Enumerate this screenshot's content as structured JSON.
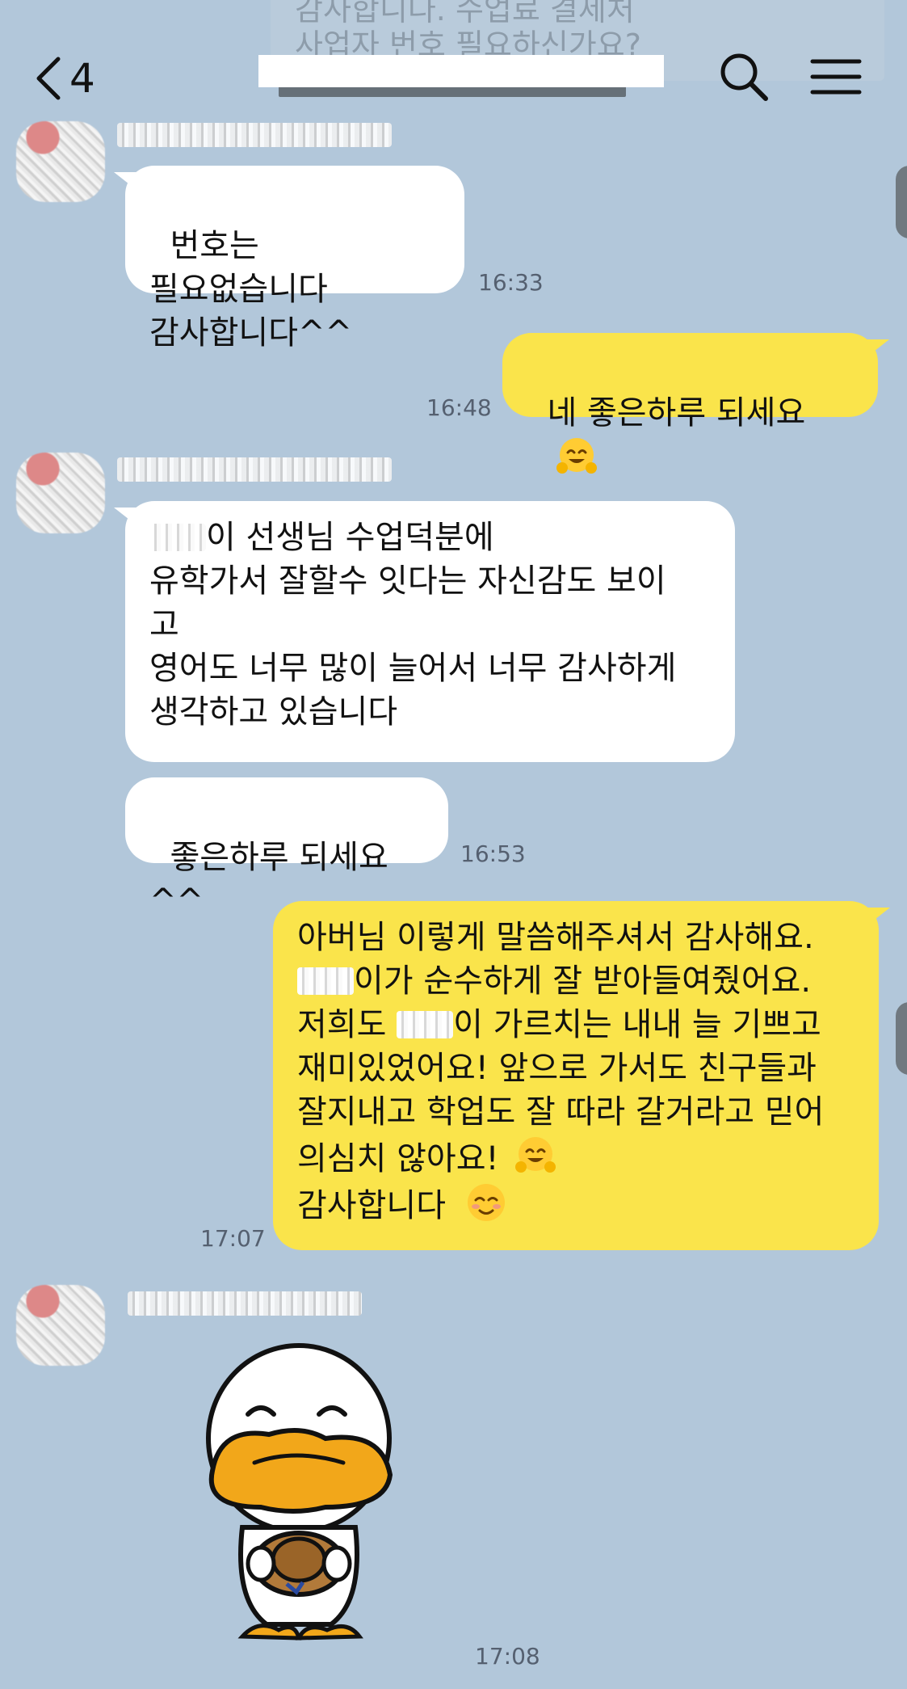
{
  "header": {
    "back_count": "4",
    "ghost_notice_line1": "감사합니다. 수업료 결제처",
    "ghost_notice_line2": "사업자 번호 필요하신가요?"
  },
  "messages": [
    {
      "side": "in",
      "text": "번호는 필요없습니다\n감사합니다^^",
      "time": "16:33"
    },
    {
      "side": "out",
      "text": "네 좋은하루 되세요",
      "time": "16:48"
    },
    {
      "side": "in",
      "text_parts": [
        "이 선생님 수업덕분에\n유학가서 잘할수 잇다는 자신감도 보이\n고\n영어도 너무 많이 늘어서 너무 감사하게\n생각하고 있습니다"
      ]
    },
    {
      "side": "in",
      "text": "좋은하루 되세요^^",
      "time": "16:53"
    },
    {
      "side": "out",
      "line1": "아버님 이렇게 말씀해주셔서 감사해요.",
      "line2": "이가 순수하게 잘 받아들여줬어요.",
      "line3a": "저희도 ",
      "line3b": "이 가르치는 내내 늘 기쁘고",
      "line4": "재미있었어요! 앞으로 가서도 친구들과",
      "line5": "잘지내고 학업도 잘 따라 갈거라고 믿어",
      "line6": "의심치 않아요!",
      "line7": "감사합니다",
      "time": "17:07"
    },
    {
      "side": "in",
      "type": "sticker",
      "sticker": "duck-with-hat-bowing",
      "time": "17:08"
    }
  ],
  "colors": {
    "background": "#b2c7da",
    "incoming": "#ffffff",
    "outgoing": "#fae44b",
    "time": "#556070"
  },
  "icons": [
    "chevron-left-icon",
    "search-icon",
    "menu-icon",
    "hugging-face-emoji",
    "smiling-face-emoji"
  ]
}
